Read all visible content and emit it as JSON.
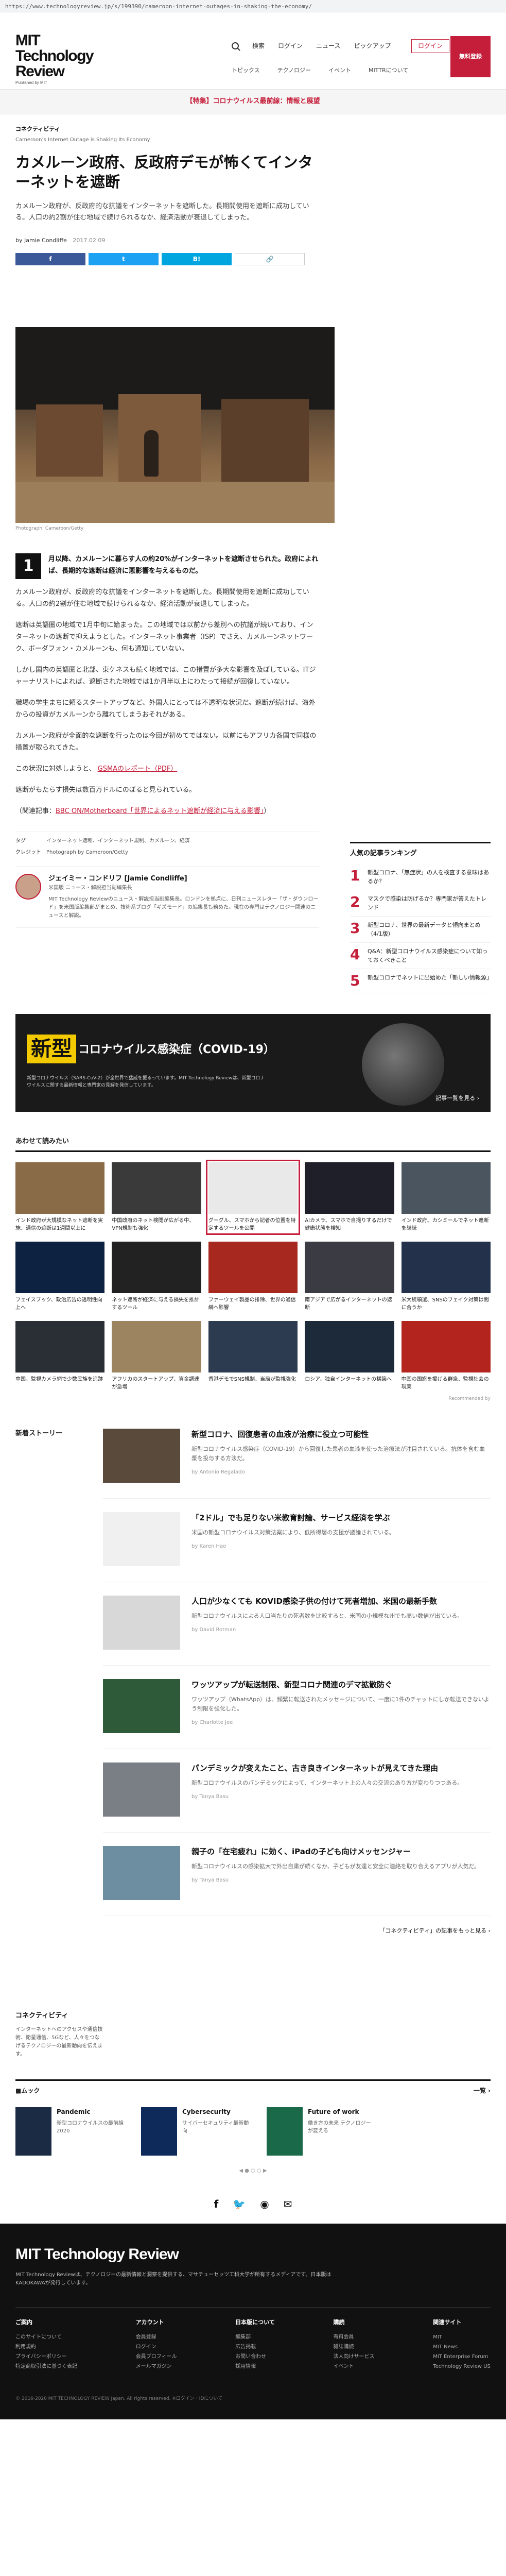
{
  "browser": {
    "url": "https://www.technologyreview.jp/s/199390/cameroon-internet-outages-in-shaking-the-economy/"
  },
  "header": {
    "logo_line1": "MIT",
    "logo_line2": "Technology",
    "logo_line3": "Review",
    "logo_sub": "Published by MIT",
    "nav": [
      "検索",
      "ログイン",
      "ニュース",
      "ピックアップ"
    ],
    "subnav": [
      "トピックス",
      "テクノロジー",
      "イベント",
      "MITTRについて"
    ],
    "login": "ログイン",
    "subscribe": "無料登録"
  },
  "alert": {
    "text": "【特集】コロナウイルス最前線：情報と展望"
  },
  "article": {
    "kicker": "コネクティビティ",
    "tags": "Cameroon’s Internet Outage is Shaking Its Economy",
    "title": "カメルーン政府、反政府デモが怖くてインターネットを遮断",
    "deck": "カメルーン政府が、反政府的な抗議をインターネットを遮断した。長期間使用を遮断に成功している。人口の約2割が住む地域で続けられるなか、経済活動が衰退してしまった。",
    "author": "by Jamie Condliffe",
    "date": "2017.02.09",
    "share": {
      "facebook": "f",
      "twitter": "t",
      "hatena": "B!",
      "link": "🔗"
    },
    "caption": "Photograph: Cameroon/Getty",
    "lead_num": "1",
    "lead_text": "月以降、カメルーンに暮らす人の約20%がインターネットを遮断させられた。政府によれば、長期的な遮断は経済に悪影響を与えるものだ。",
    "paragraphs": [
      "カメルーン政府が、反政府的な抗議をインターネットを遮断した。長期間使用を遮断に成功している。人口の約2割が住む地域で続けられるなか、経済活動が衰退してしまった。",
      "遮断は英語圏の地域で1月中旬に始まった。この地域では以前から差別への抗議が続いており、インターネットの遮断で抑えようとした。インターネット事業者（ISP）でさえ、カメルーンネットワーク、ボーダフォン・カメルーンも、何も通知していない。",
      "しかし国内の英語圏と北部、東ケネスも続く地域では、この措置が多大な影響を及ぼしている。ITジャーナリストによれば、遮断された地域では1か月半以上にわたって接続が回復していない。",
      "職場の学生まちに頼るスタートアップなど、外国人にとっては不透明な状況だ。遮断が続けば、海外からの投資がカメルーンから離れてしまうおそれがある。",
      "カメルーン政府が全面的な遮断を行ったのは今回が初めてではない。以前にもアフリカ各国で同様の措置が取られてきた。",
      "この状況に対処しようと、",
      "遮断がもたらす損失は数百万ドルにのぼると見られている。"
    ],
    "link_text": "GSMAのレポート（PDF）",
    "quote_label": "（関連記事：",
    "quote_link": "BBC ON/Motherboard「世界によるネット遮断が経済に与える影響」",
    "quote_end": "）",
    "meta": {
      "tags_label": "タグ",
      "tags_value": "インターネット遮断、インターネット規制、カメルーン、経済",
      "credit_label": "クレジット",
      "credit_value": "Photograph by Cameroon/Getty"
    }
  },
  "author_box": {
    "name": "ジェイミー・コンドリフ [Jamie Condliffe]",
    "role": "米国版 ニュース・解説担当副編集長",
    "bio": "MIT Technology Reviewのニュース・解説担当副編集長。ロンドンを拠点に、日刊ニュースレター「ザ・ダウンロード」を米国版編集部がまとめ、技術系ブログ「ギズモード」の編集長も務めた。現在の専門はテクノロジー関連のニュースと解説。"
  },
  "ranking": {
    "title": "人気の記事ランキング",
    "items": [
      {
        "n": "1",
        "t": "新型コロナ、「無症状」の人を検査する意味はあるか？",
        "s": ""
      },
      {
        "n": "2",
        "t": "マスクで感染は防げるか？専門家が答えたトレンド",
        "s": ""
      },
      {
        "n": "3",
        "t": "新型コロナ、世界の最新データと傾向まとめ（4/1版）",
        "s": ""
      },
      {
        "n": "4",
        "t": "Q&A：新型コロナウイルス感染症について知っておくべきこと",
        "s": ""
      },
      {
        "n": "5",
        "t": "新型コロナでネットに出始めた「新しい情報源」",
        "s": ""
      }
    ]
  },
  "covid": {
    "badge": "新型",
    "title": "コロナウイルス感染症（COVID-19）",
    "text": "新型コロナウイルス（SARS-CoV-2）が全世界で猛威を振るっています。MIT Technology Reviewは、新型コロナウイルスに関する最新情報と専門家の見解を発信しています。",
    "more": "記事一覧を見る ›"
  },
  "related": {
    "title": "あわせて読みたい",
    "cards": [
      "インド政府が大規模なネット遮断を実施、通信の遮断は1週間以上に",
      "中国政府のネット検閲が広がる中、VPN規制も強化",
      "グーグル、スマホから記者の位置を特定するツールを公開",
      "AIカメラ、スマホで自撮りするだけで健康状態を検知",
      "インド政府、カシミールでネット遮断を継続",
      "フェイスブック、政治広告の透明性向上へ",
      "ネット遮断が経済に与える損失を推計するツール",
      "ファーウェイ製品の排除、世界の通信網へ影響",
      "南アジアで広がるインターネットの遮断",
      "米大統領選、SNSのフェイク対策は間に合うか",
      "中国、監視カメラ網で少数民族を追跡",
      "アフリカのスタートアップ、資金調達が急増",
      "香港デモでSNS規制、当局が監視強化",
      "ロシア、独自インターネットの構築へ",
      "中国の国旗を掲げる群衆、監視社会の現実"
    ],
    "ad_note": "Recommended by"
  },
  "stories": {
    "label": "新着ストーリー",
    "items": [
      {
        "t": "新型コロナ、回復患者の血液が治療に役立つ可能性",
        "d": "新型コロナウイルス感染症（COVID-19）から回復した患者の血液を使った治療法が注目されている。抗体を含む血漿を投与する方法だ。",
        "a": "by Antonio Regalado"
      },
      {
        "t": "「2ドル」でも足りない米教育討論、サービス経済を学ぶ",
        "d": "米国の新型コロナウイルス対策法案により、低所得層の支援が議論されている。",
        "a": "by Karen Hao"
      },
      {
        "t": "人口が少なくても KOVID感染子供の付けて死者増加、米国の最新手数",
        "d": "新型コロナウイルスによる人口当たりの死者数を比較すると、米国の小規模な州でも高い数値が出ている。",
        "a": "by David Rotman"
      },
      {
        "t": "ワッツアップが転送制限、新型コロナ関連のデマ拡散防ぐ",
        "d": "ワッツアップ（WhatsApp）は、頻繁に転送されたメッセージについて、一度に1件のチャットにしか転送できないよう制限を強化した。",
        "a": "by Charlotte Jee"
      },
      {
        "t": "パンデミックが変えたこと、古き良きインターネットが見えてきた理由",
        "d": "新型コロナウイルスのパンデミックによって、インターネット上の人々の交流のあり方が変わりつつある。",
        "a": "by Tanya Basu"
      },
      {
        "t": "親子の「在宅疲れ」に効く、iPadの子ども向けメッセンジャー",
        "d": "新型コロナウイルスの感染拡大で外出自粛が続くなか、子どもが友達と安全に連絡を取り合えるアプリが人気だ。",
        "a": "by Tanya Basu"
      }
    ],
    "side_h": "コネクティビティ",
    "side_p": "インターネットへのアクセスや通信技術、衛星通信、5Gなど、人々をつなげるテクノロジーの最新動向を伝えます。",
    "more": "「コネクティビティ」の記事をもっと見る ›"
  },
  "mook": {
    "title": "■ムック",
    "link": "一覧 ›",
    "items": [
      {
        "name": "Pandemic",
        "info": "新型コロナウイルスの最前線 2020"
      },
      {
        "name": "Cybersecurity",
        "info": "サイバーセキュリティ最新動向"
      },
      {
        "name": "Future of work",
        "info": "働き方の未来 テクノロジーが変える"
      }
    ],
    "paging": "◀ ● ○ ○ ▶"
  },
  "footer": {
    "social": [
      "f",
      "🐦",
      "◉",
      "✉"
    ],
    "logo": "MIT Technology Review",
    "desc": "MIT Technology Reviewは、テクノロジーの最新情報と洞察を提供する、マサチューセッツ工科大学が所有するメディアです。日本版はKADOKAWAが発行しています。",
    "cols": [
      {
        "h": "ご案内",
        "items": [
          "このサイトについて",
          "利用規約",
          "プライバシーポリシー",
          "特定商取引法に基づく表記"
        ]
      },
      {
        "h": "アカウント",
        "items": [
          "会員登録",
          "ログイン",
          "会員プロフィール",
          "メールマガジン"
        ]
      },
      {
        "h": "日本版について",
        "items": [
          "編集部",
          "広告掲載",
          "お問い合わせ",
          "採用情報"
        ]
      },
      {
        "h": "購読",
        "items": [
          "有料会員",
          "雑誌購読",
          "法人向けサービス",
          "イベント"
        ]
      },
      {
        "h": "関連サイト",
        "items": [
          "MIT",
          "MIT News",
          "MIT Enterprise Forum",
          "Technology Review US"
        ]
      }
    ],
    "copyright": "© 2016-2020 MIT TECHNOLOGY REVIEW Japan. All rights reserved. ※ログイン・IDについて"
  }
}
